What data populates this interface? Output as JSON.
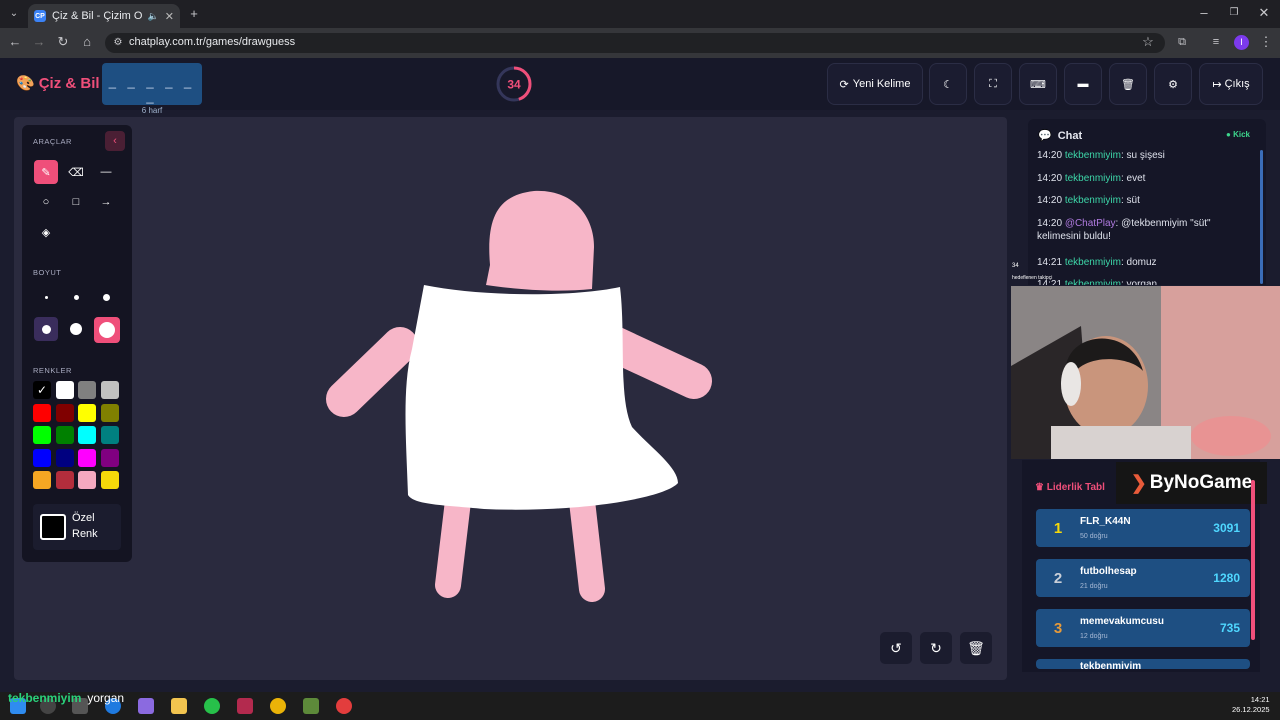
{
  "browser": {
    "tab_title": "Çiz & Bil - Çizim Oyunu",
    "tab_favicon": "CP",
    "url": "chatplay.com.tr/games/drawguess",
    "profile_initial": "I"
  },
  "header": {
    "logo": "Çiz & Bil",
    "word_mask": "_ _ _ _ _ _",
    "word_hint": "6 harf",
    "timer": "34",
    "timer_fraction": 0.45,
    "buttons": {
      "new_word": "Yeni Kelime",
      "exit": "Çıkış"
    }
  },
  "tools": {
    "title": "ARAÇLAR",
    "size_title": "BOYUT",
    "colors_title": "RENKLER",
    "custom_color_line1": "Özel",
    "custom_color_line2": "Renk",
    "palette": [
      "#000000",
      "#ffffff",
      "#808080",
      "#c0c0c0",
      "#ff0000",
      "#800000",
      "#ffff00",
      "#808000",
      "#00ff00",
      "#008000",
      "#00ffff",
      "#008080",
      "#0000ff",
      "#000080",
      "#ff00ff",
      "#800080",
      "#f5a623",
      "#b22d3c",
      "#f4a9c0",
      "#f5d90a"
    ]
  },
  "chat": {
    "title": "Chat",
    "platform": "Kick",
    "messages": [
      {
        "time": "14:20",
        "user": "tekbenmiyim",
        "text": ": su şişesi"
      },
      {
        "time": "14:20",
        "user": "tekbenmiyim",
        "text": ": evet"
      },
      {
        "time": "14:20",
        "user": "tekbenmiyim",
        "text": ": süt"
      },
      {
        "time": "14:20",
        "user": "@ChatPlay",
        "text": ": @tekbenmiyim \"süt\" kelimesini buldu!"
      },
      {
        "time": "14:21",
        "user": "tekbenmiyim",
        "text": ": domuz"
      },
      {
        "time": "14:21",
        "user": "tekbenmiyim",
        "text": ": yorgan"
      }
    ]
  },
  "overlay": {
    "small_num": "34",
    "small_text": "hedeflenen takipçi",
    "sponsor": "ByNoGame"
  },
  "leaderboard": {
    "title": "Liderlik Tabl",
    "rows": [
      {
        "rank": "1",
        "name": "FLR_K44N",
        "sub": "50 doğru",
        "score": "3091",
        "rank_color": "#f5d90a"
      },
      {
        "rank": "2",
        "name": "futbolhesap",
        "sub": "21 doğru",
        "score": "1280",
        "rank_color": "#c9cfd8"
      },
      {
        "rank": "3",
        "name": "memevakumcusu",
        "sub": "12 doğru",
        "score": "735",
        "rank_color": "#e69a3a"
      },
      {
        "rank": "",
        "name": "tekbenmiyim",
        "sub": "",
        "score": "",
        "rank_color": "#c9cfd8"
      }
    ]
  },
  "stream_chat": {
    "user": "tekbenmiyim",
    "text": "yorgan"
  },
  "taskbar": {
    "time": "14:21",
    "date": "26.12.2025"
  }
}
